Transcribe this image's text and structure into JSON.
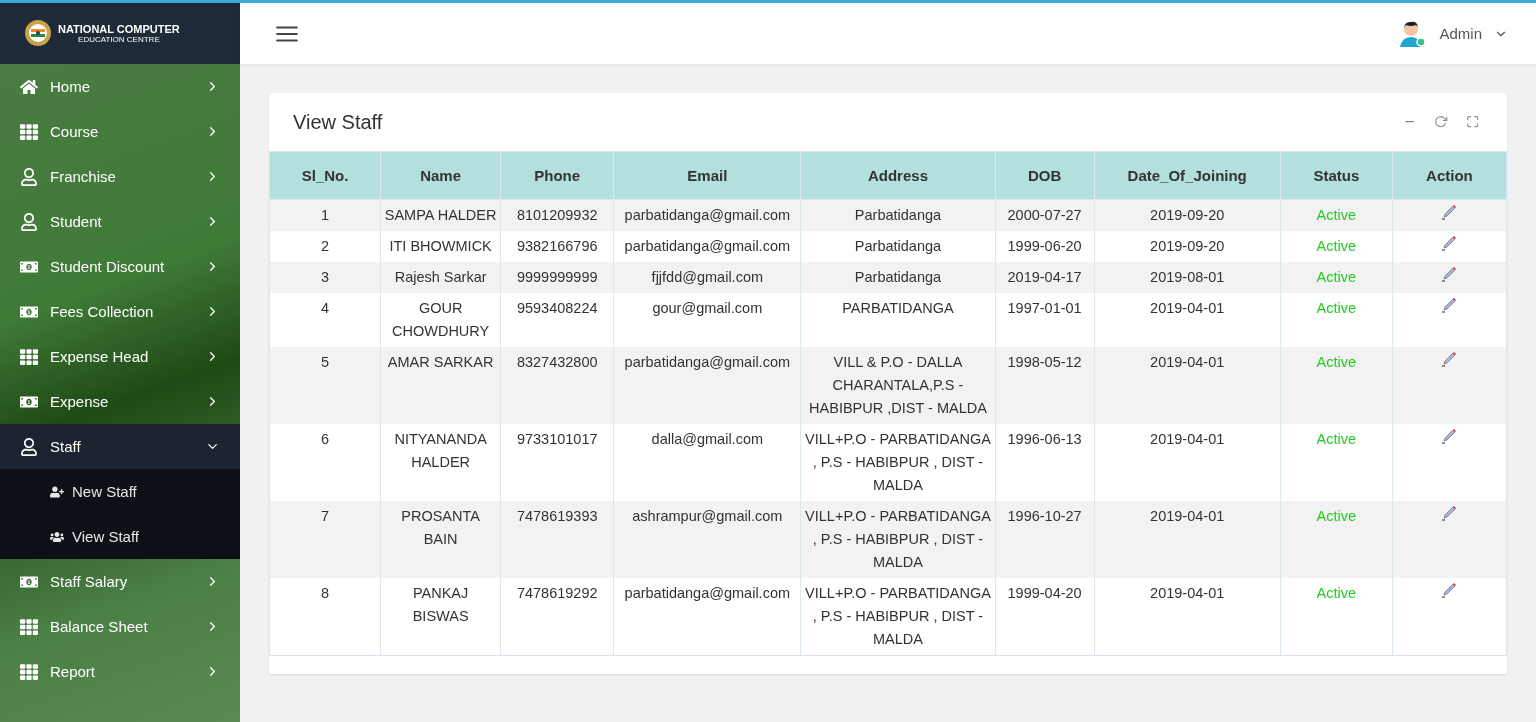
{
  "brand": {
    "line1": "NATIONAL COMPUTER",
    "line2": "EDUCATION CENTRE"
  },
  "header": {
    "user": "Admin"
  },
  "sidebar": {
    "items": [
      {
        "label": "Home",
        "kind": "home",
        "expanded": false
      },
      {
        "label": "Course",
        "kind": "grid",
        "expanded": false
      },
      {
        "label": "Franchise",
        "kind": "user",
        "expanded": false
      },
      {
        "label": "Student",
        "kind": "user",
        "expanded": false
      },
      {
        "label": "Student Discount",
        "kind": "money",
        "expanded": false
      },
      {
        "label": "Fees Collection",
        "kind": "money",
        "expanded": false
      },
      {
        "label": "Expense Head",
        "kind": "grid",
        "expanded": false
      },
      {
        "label": "Expense",
        "kind": "money",
        "expanded": false
      },
      {
        "label": "Staff",
        "kind": "user",
        "expanded": true,
        "children": [
          {
            "label": "New Staff",
            "kind": "useradd"
          },
          {
            "label": "View Staff",
            "kind": "users"
          }
        ]
      },
      {
        "label": "Staff Salary",
        "kind": "money",
        "expanded": false
      },
      {
        "label": "Balance Sheet",
        "kind": "grid",
        "expanded": false
      },
      {
        "label": "Report",
        "kind": "grid",
        "expanded": false
      }
    ]
  },
  "panel": {
    "title": "View Staff"
  },
  "table": {
    "columns": [
      "Sl_No.",
      "Name",
      "Phone",
      "Email",
      "Address",
      "DOB",
      "Date_Of_Joining",
      "Status",
      "Action"
    ],
    "rows": [
      [
        "1",
        "SAMPA HALDER",
        "8101209932",
        "parbatidanga@gmail.com",
        "Parbatidanga",
        "2000-07-27",
        "2019-09-20",
        "Active"
      ],
      [
        "2",
        "ITI BHOWMICK",
        "9382166796",
        "parbatidanga@gmail.com",
        "Parbatidanga",
        "1999-06-20",
        "2019-09-20",
        "Active"
      ],
      [
        "3",
        "Rajesh Sarkar",
        "9999999999",
        "fjjfdd@gmail.com",
        "Parbatidanga",
        "2019-04-17",
        "2019-08-01",
        "Active"
      ],
      [
        "4",
        "GOUR CHOWDHURY",
        "9593408224",
        "gour@gmail.com",
        "PARBATIDANGA",
        "1997-01-01",
        "2019-04-01",
        "Active"
      ],
      [
        "5",
        "AMAR SARKAR",
        "8327432800",
        "parbatidanga@gmail.com",
        "VILL & P.O - DALLA CHARANTALA,P.S - HABIBPUR ,DIST - MALDA",
        "1998-05-12",
        "2019-04-01",
        "Active"
      ],
      [
        "6",
        "NITYANANDA HALDER",
        "9733101017",
        "dalla@gmail.com",
        "VILL+P.O - PARBATIDANGA , P.S - HABIBPUR , DIST - MALDA",
        "1996-06-13",
        "2019-04-01",
        "Active"
      ],
      [
        "7",
        "PROSANTA BAIN",
        "7478619393",
        "ashrampur@gmail.com",
        "VILL+P.O - PARBATIDANGA , P.S - HABIBPUR , DIST - MALDA",
        "1996-10-27",
        "2019-04-01",
        "Active"
      ],
      [
        "8",
        "PANKAJ BISWAS",
        "7478619292",
        "parbatidanga@gmail.com",
        "VILL+P.O - PARBATIDANGA , P.S - HABIBPUR , DIST - MALDA",
        "1999-04-20",
        "2019-04-01",
        "Active"
      ]
    ]
  }
}
